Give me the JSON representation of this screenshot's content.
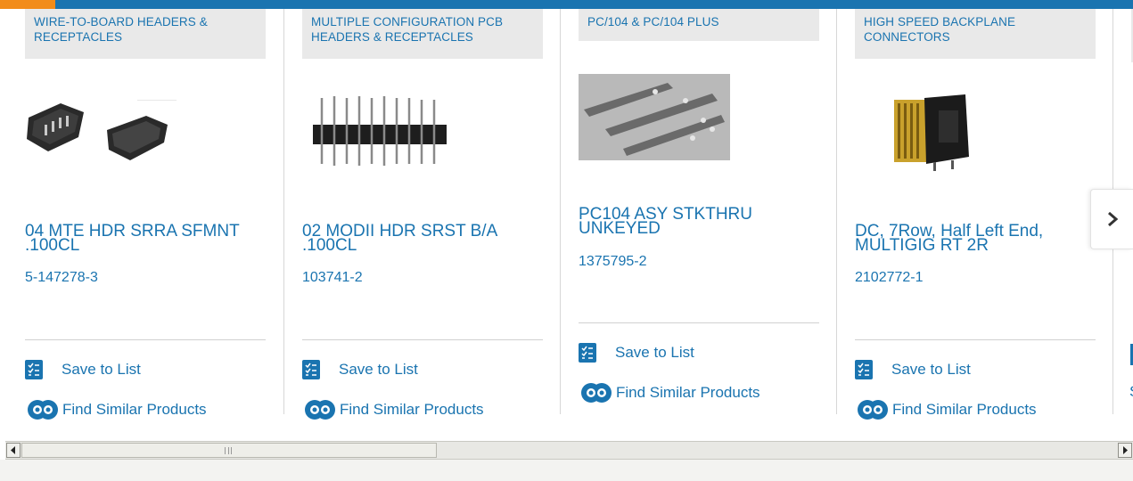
{
  "carousel": {
    "cards": [
      {
        "category": "WIRE-TO-BOARD HEADERS & RECEPTACLES",
        "title": "04 MTE HDR SRRA SFMNT .100CL",
        "part_number": "5-147278-3",
        "save_label": "Save to List",
        "similar_label": "Find Similar Products"
      },
      {
        "category": "MULTIPLE CONFIGURATION PCB HEADERS & RECEPTACLES",
        "title": "02 MODII HDR SRST B/A .100CL",
        "part_number": "103741-2",
        "save_label": "Save to List",
        "similar_label": "Find Similar Products"
      },
      {
        "category": "PC/104 & PC/104 PLUS",
        "title": "PC104 ASY STKTHRU UNKEYED",
        "part_number": "1375795-2",
        "save_label": "Save to List",
        "similar_label": "Find Similar Products"
      },
      {
        "category": "HIGH SPEED BACKPLANE CONNECTORS",
        "title": "DC, 7Row, Half Left End, MULTIGIG RT 2R",
        "part_number": "2102772-1",
        "save_label": "Save to List",
        "similar_label": "Find Similar Products"
      }
    ],
    "next_icon": "chevron-right-icon",
    "peek_text": "S"
  },
  "colors": {
    "accent_blue": "#1a74b0",
    "accent_orange": "#f28c1a",
    "category_bg": "#e9e9e9"
  }
}
